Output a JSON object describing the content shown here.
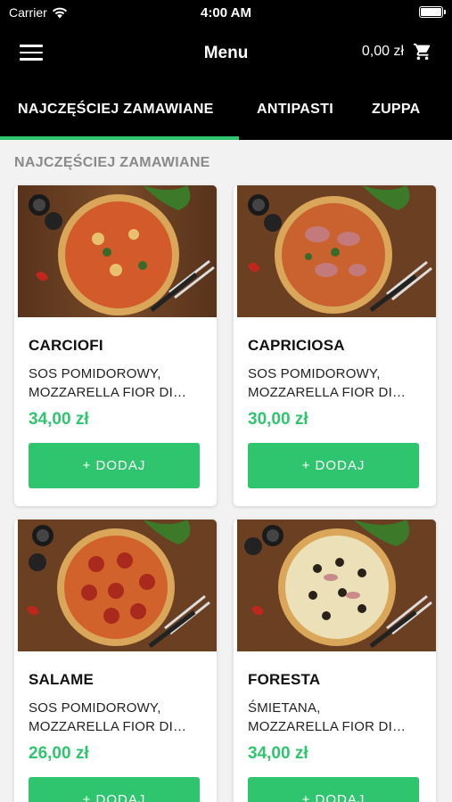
{
  "status_bar": {
    "carrier": "Carrier",
    "time": "4:00 AM"
  },
  "nav": {
    "title": "Menu",
    "cart_total": "0,00 zł",
    "menu_icon": "hamburger-icon",
    "cart_icon": "cart-icon"
  },
  "tabs": [
    "NAJCZĘŚCIEJ ZAMAWIANE",
    "ANTIPASTI",
    "ZUPPA"
  ],
  "active_tab": 0,
  "section_title": "NAJCZĘŚCIEJ ZAMAWIANE",
  "colors": {
    "accent": "#2fc56e",
    "header": "#000000",
    "background": "#f2f2f2"
  },
  "products": [
    {
      "name": "CARCIOFI",
      "description": "SOS POMIDOROWY,\nMOZZARELLA FIOR DI…",
      "price": "34,00 zł",
      "button": "+ DODAJ"
    },
    {
      "name": "CAPRICIOSA",
      "description": "SOS POMIDOROWY,\nMOZZARELLA FIOR DI…",
      "price": "30,00 zł",
      "button": "+ DODAJ"
    },
    {
      "name": "SALAME",
      "description": "SOS POMIDOROWY,\nMOZZARELLA FIOR DI…",
      "price": "26,00 zł",
      "button": "+ DODAJ"
    },
    {
      "name": "FORESTA",
      "description": "ŚMIETANA,\nMOZZARELLA FIOR DI…",
      "price": "34,00 zł",
      "button": "+ DODAJ"
    }
  ]
}
